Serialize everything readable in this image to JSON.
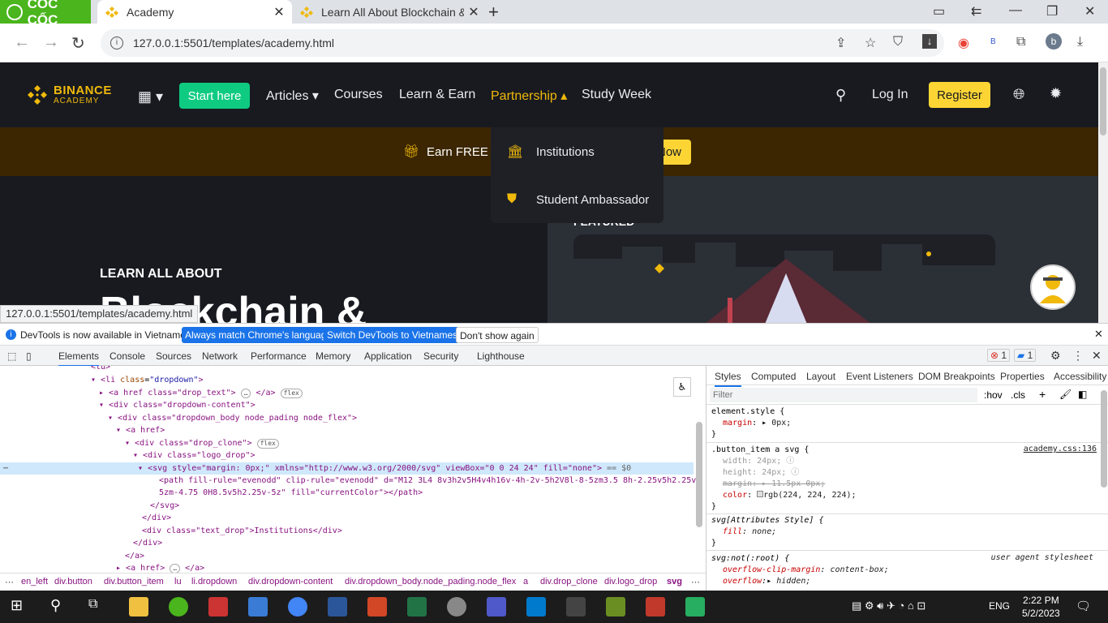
{
  "browser": {
    "brand": "CỐC CỐC",
    "tabs": [
      {
        "title": "Academy",
        "active": true
      },
      {
        "title": "Learn All About Blockchain &",
        "active": false
      }
    ],
    "url": "127.0.0.1:5501/templates/academy.html",
    "profile_initial": "b",
    "status_url": "127.0.0.1:5501/templates/academy.html"
  },
  "site": {
    "logo_top": "BINANCE",
    "logo_bottom": "ACADEMY",
    "start_here": "Start here",
    "nav": [
      {
        "label": "Articles",
        "has_caret": true
      },
      {
        "label": "Courses"
      },
      {
        "label": "Learn & Earn"
      },
      {
        "label": "Partnership",
        "has_caret": true,
        "active": true
      },
      {
        "label": "Study Week"
      }
    ],
    "login": "Log In",
    "register": "Register",
    "promo_text": "Earn FREE C",
    "promo_button": "Now",
    "dropdown": [
      {
        "label": "Institutions",
        "icon": "bank-icon"
      },
      {
        "label": "Student Ambassador",
        "icon": "badge-icon"
      }
    ],
    "learn_all": "LEARN ALL ABOUT",
    "hero_title": "Blockchain &",
    "featured": "FEATURED",
    "colors": {
      "brand": "#f0b90b",
      "start": "#0ecb81",
      "register": "#fcd535",
      "bg": "#181a20"
    }
  },
  "devtools": {
    "infobar": {
      "message": "DevTools is now available in Vietnamese!",
      "btn_match": "Always match Chrome's language",
      "btn_switch": "Switch DevTools to Vietnamese",
      "btn_dismiss": "Don't show again"
    },
    "tabs": [
      "Elements",
      "Console",
      "Sources",
      "Network",
      "Performance",
      "Memory",
      "Application",
      "Security",
      "Lighthouse"
    ],
    "errors": "1",
    "messages": "1",
    "elements": {
      "l0": "<lu>",
      "l1a": "<li ",
      "l1b": "class",
      "l1c": "\"dropdown\"",
      "l1d": ">",
      "l2": "<a href class=\"drop_text\">",
      "l2e": "</a>",
      "l3": "<div class=\"dropdown-content\">",
      "l4": "<div class=\"dropdown_body node_pading node_flex\">",
      "l5": "<a href>",
      "l6": "<div class=\"drop_clone\">",
      "l7": "<div class=\"logo_drop\">",
      "l8": "<svg style=\"margin: 0px;\" xmlns=\"http://www.w3.org/2000/svg\" viewBox=\"0 0 24 24\" fill=\"none\">",
      "l8eq": " == $0",
      "l9": "<path fill-rule=\"evenodd\" clip-rule=\"evenodd\" d=\"M12 3L4 8v3h2v5H4v4h16v-4h-2v-5h2V8l-8-5zm3.5 8h-2.25v5h2.25v-",
      "l10": "5zm-4.75 0H8.5v5h2.25v-5z\" fill=\"currentColor\"></path>",
      "l11": "</svg>",
      "l12": "</div>",
      "l13": "<div class=\"text_drop\">Institutions</div>",
      "l14": "</div>",
      "l15": "</a>",
      "l16": "<a href>",
      "l16e": "</a>",
      "flex": "flex"
    },
    "breadcrumbs": [
      "en_left",
      "div.button",
      "div.button_item",
      "lu",
      "li.dropdown",
      "div.dropdown-content",
      "div.dropdown_body.node_pading.node_flex",
      "a",
      "div.drop_clone",
      "div.logo_drop",
      "svg"
    ],
    "styles_tabs": [
      "Styles",
      "Computed",
      "Layout",
      "Event Listeners",
      "DOM Breakpoints",
      "Properties",
      "Accessibility"
    ],
    "filter_placeholder": "Filter",
    "hov": ":hov",
    "cls": ".cls",
    "rules": {
      "r1_sel": "element.style {",
      "r1_p": "margin",
      "r1_v": "0px;",
      "r2_sel": ".button_item a svg {",
      "r2_src": "academy.css:136",
      "r2_p1": "width",
      "r2_v1": "24px;",
      "r2_p2": "height",
      "r2_v2": "24px;",
      "r2_p3": "margin",
      "r2_v3": "11.5px 0px;",
      "r2_p4": "color",
      "r2_v4": "rgb(224, 224, 224);",
      "r3_sel": "svg[Attributes Style] {",
      "r3_p": "fill",
      "r3_v": "none;",
      "r4_sel": "svg:not(:root) {",
      "r4_src": "user agent stylesheet",
      "r4_p1": "overflow-clip-margin",
      "r4_v1": "content-box;",
      "r4_p2": "overflow",
      "r4_v2": "hidden;",
      "close": "}"
    }
  },
  "taskbar": {
    "lang": "ENG",
    "time": "2:22 PM",
    "date": "5/2/2023"
  }
}
